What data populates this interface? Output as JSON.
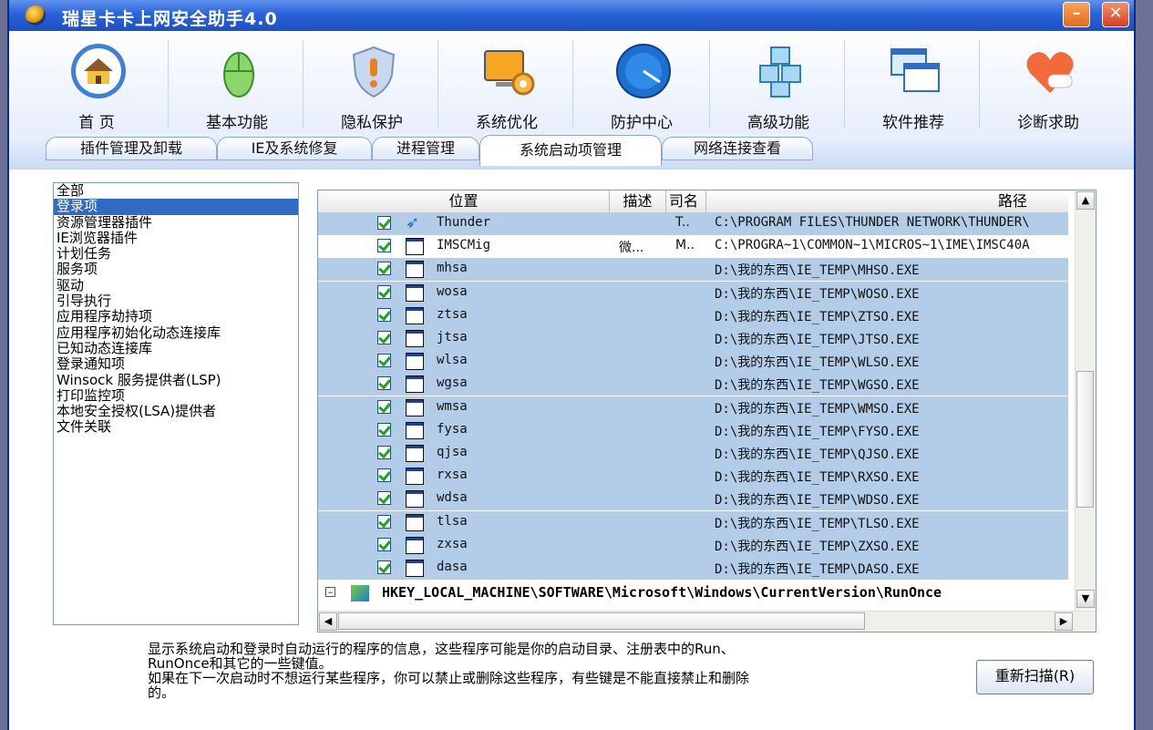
{
  "window": {
    "title": "瑞星卡卡上网安全助手4.0"
  },
  "toolbar": [
    {
      "label": "首 页",
      "icon": "home-icon"
    },
    {
      "label": "基本功能",
      "icon": "mouse-icon"
    },
    {
      "label": "隐私保护",
      "icon": "shield-icon"
    },
    {
      "label": "系统优化",
      "icon": "monitor-gear-icon"
    },
    {
      "label": "防护中心",
      "icon": "radar-icon"
    },
    {
      "label": "高级功能",
      "icon": "cubes-icon"
    },
    {
      "label": "软件推荐",
      "icon": "windows-icon"
    },
    {
      "label": "诊断求助",
      "icon": "heart-hand-icon"
    }
  ],
  "subtabs": [
    "插件管理及卸载",
    "IE及系统修复",
    "进程管理",
    "系统启动项管理",
    "网络连接查看"
  ],
  "active_subtab": 3,
  "categories": [
    "全部",
    "登录项",
    "资源管理器插件",
    "IE浏览器插件",
    "计划任务",
    "服务项",
    "驱动",
    "引导执行",
    "应用程序劫持项",
    "应用程序初始化动态连接库",
    "已知动态连接库",
    "登录通知项",
    "Winsock 服务提供者(LSP)",
    "打印监控项",
    "本地安全授权(LSA)提供者",
    "文件关联"
  ],
  "selected_category": 1,
  "grid": {
    "headers": {
      "location": "位置",
      "desc": "描述",
      "company": "司名",
      "path": "路径"
    },
    "rows": [
      {
        "name": "Thunder",
        "desc": "",
        "company": "T..",
        "path": "C:\\PROGRAM FILES\\THUNDER NETWORK\\THUNDER\\"
      },
      {
        "name": "IMSCMig",
        "desc": "微...",
        "company": "M..",
        "path": "C:\\PROGRA~1\\COMMON~1\\MICROS~1\\IME\\IMSC40A"
      },
      {
        "name": "mhsa",
        "desc": "",
        "company": "",
        "path": "D:\\我的东西\\IE_TEMP\\MHSO.EXE"
      },
      {
        "name": "wosa",
        "desc": "",
        "company": "",
        "path": "D:\\我的东西\\IE_TEMP\\WOSO.EXE"
      },
      {
        "name": "ztsa",
        "desc": "",
        "company": "",
        "path": "D:\\我的东西\\IE_TEMP\\ZTSO.EXE"
      },
      {
        "name": "jtsa",
        "desc": "",
        "company": "",
        "path": "D:\\我的东西\\IE_TEMP\\JTSO.EXE"
      },
      {
        "name": "wlsa",
        "desc": "",
        "company": "",
        "path": "D:\\我的东西\\IE_TEMP\\WLSO.EXE"
      },
      {
        "name": "wgsa",
        "desc": "",
        "company": "",
        "path": "D:\\我的东西\\IE_TEMP\\WGSO.EXE"
      },
      {
        "name": "wmsa",
        "desc": "",
        "company": "",
        "path": "D:\\我的东西\\IE_TEMP\\WMSO.EXE"
      },
      {
        "name": "fysa",
        "desc": "",
        "company": "",
        "path": "D:\\我的东西\\IE_TEMP\\FYSO.EXE"
      },
      {
        "name": "qjsa",
        "desc": "",
        "company": "",
        "path": "D:\\我的东西\\IE_TEMP\\QJSO.EXE"
      },
      {
        "name": "rxsa",
        "desc": "",
        "company": "",
        "path": "D:\\我的东西\\IE_TEMP\\RXSO.EXE"
      },
      {
        "name": "wdsa",
        "desc": "",
        "company": "",
        "path": "D:\\我的东西\\IE_TEMP\\WDSO.EXE"
      },
      {
        "name": "tlsa",
        "desc": "",
        "company": "",
        "path": "D:\\我的东西\\IE_TEMP\\TLSO.EXE"
      },
      {
        "name": "zxsa",
        "desc": "",
        "company": "",
        "path": "D:\\我的东西\\IE_TEMP\\ZXSO.EXE"
      },
      {
        "name": "dasa",
        "desc": "",
        "company": "",
        "path": "D:\\我的东西\\IE_TEMP\\DASO.EXE"
      }
    ],
    "reg_key": "HKEY_LOCAL_MACHINE\\SOFTWARE\\Microsoft\\Windows\\CurrentVersion\\RunOnce"
  },
  "info": {
    "line1": "显示系统启动和登录时自动运行的程序的信息，这些程序可能是你的启动目录、注册表中的Run、",
    "line2": "RunOnce和其它的一些键值。",
    "line3": "如果在下一次启动时不想运行某些程序，你可以禁止或删除这些程序，有些键是不能直接禁止和删除",
    "line4": "的。"
  },
  "rescan_label": "重新扫描(R)"
}
